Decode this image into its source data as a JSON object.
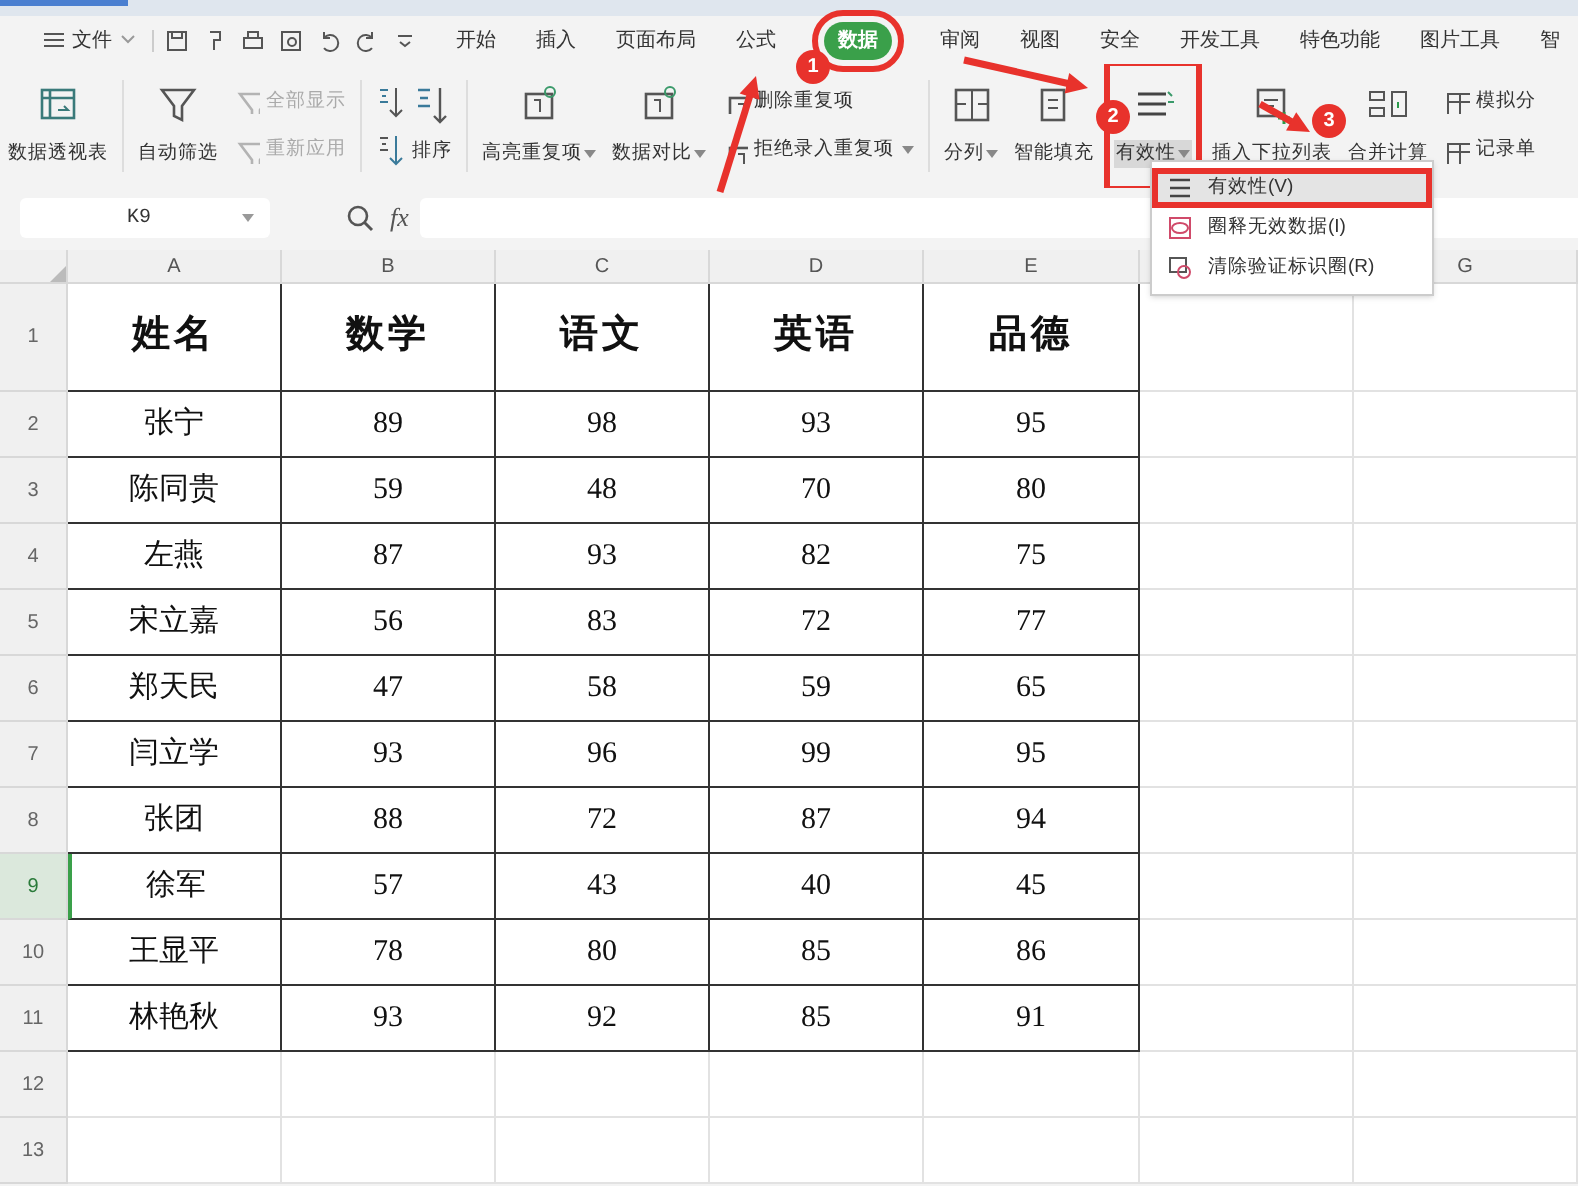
{
  "menu_bar": {
    "file": "文件",
    "tabs": [
      {
        "label": "开始",
        "selected": false
      },
      {
        "label": "插入",
        "selected": false
      },
      {
        "label": "页面布局",
        "selected": false
      },
      {
        "label": "公式",
        "selected": false
      },
      {
        "label": "数据",
        "selected": true
      },
      {
        "label": "审阅",
        "selected": false
      },
      {
        "label": "视图",
        "selected": false
      },
      {
        "label": "安全",
        "selected": false
      },
      {
        "label": "开发工具",
        "selected": false
      },
      {
        "label": "特色功能",
        "selected": false
      },
      {
        "label": "图片工具",
        "selected": false
      },
      {
        "label": "智",
        "selected": false
      }
    ]
  },
  "ribbon": [
    {
      "kind": "big",
      "label": "数据透视表",
      "dropdown": false,
      "selected": false
    },
    {
      "kind": "big",
      "label": "自动筛选",
      "dropdown": false,
      "selected": false
    },
    {
      "kind": "pair",
      "items": [
        {
          "label": "全部显示",
          "disabled": true,
          "dropdown": false
        },
        {
          "label": "重新应用",
          "disabled": true,
          "dropdown": false
        }
      ]
    },
    {
      "kind": "sort",
      "label": "排序"
    },
    {
      "kind": "big",
      "label": "高亮重复项",
      "dropdown": true,
      "selected": false
    },
    {
      "kind": "big",
      "label": "数据对比",
      "dropdown": true,
      "selected": false
    },
    {
      "kind": "pair",
      "items": [
        {
          "label": "删除重复项",
          "disabled": false,
          "dropdown": false
        },
        {
          "label": "拒绝录入重复项",
          "disabled": false,
          "dropdown": true
        }
      ]
    },
    {
      "kind": "big",
      "label": "分列",
      "dropdown": true,
      "selected": false
    },
    {
      "kind": "big",
      "label": "智能填充",
      "dropdown": false,
      "selected": false
    },
    {
      "kind": "big",
      "label": "有效性",
      "dropdown": true,
      "selected": true
    },
    {
      "kind": "big",
      "label": "插入下拉列表",
      "dropdown": false,
      "selected": false
    },
    {
      "kind": "big",
      "label": "合并计算",
      "dropdown": false,
      "selected": false
    },
    {
      "kind": "pair",
      "items": [
        {
          "label": "模拟分",
          "disabled": false,
          "dropdown": false
        },
        {
          "label": "记录单",
          "disabled": false,
          "dropdown": false
        }
      ]
    }
  ],
  "dropdown_menu": [
    {
      "label": "有效性(V)",
      "selected": true
    },
    {
      "label": "圈释无效数据(I)",
      "selected": false
    },
    {
      "label": "清除验证标识圈(R)",
      "selected": false
    }
  ],
  "formula_bar": {
    "name_box": "K9",
    "fx": "fx"
  },
  "columns": [
    "A",
    "B",
    "C",
    "D",
    "E",
    null,
    "G"
  ],
  "rows": [
    {
      "number": "1",
      "selected": false,
      "cells": [
        "姓名",
        "数学",
        "语文",
        "英语",
        "品德"
      ]
    },
    {
      "number": "2",
      "selected": false,
      "cells": [
        "张宁",
        "89",
        "98",
        "93",
        "95"
      ]
    },
    {
      "number": "3",
      "selected": false,
      "cells": [
        "陈同贵",
        "59",
        "48",
        "70",
        "80"
      ]
    },
    {
      "number": "4",
      "selected": false,
      "cells": [
        "左燕",
        "87",
        "93",
        "82",
        "75"
      ]
    },
    {
      "number": "5",
      "selected": false,
      "cells": [
        "宋立嘉",
        "56",
        "83",
        "72",
        "77"
      ]
    },
    {
      "number": "6",
      "selected": false,
      "cells": [
        "郑天民",
        "47",
        "58",
        "59",
        "65"
      ]
    },
    {
      "number": "7",
      "selected": false,
      "cells": [
        "闫立学",
        "93",
        "96",
        "99",
        "95"
      ]
    },
    {
      "number": "8",
      "selected": false,
      "cells": [
        "张团",
        "88",
        "72",
        "87",
        "94"
      ]
    },
    {
      "number": "9",
      "selected": true,
      "cells": [
        "徐军",
        "57",
        "43",
        "40",
        "45"
      ]
    },
    {
      "number": "10",
      "selected": false,
      "cells": [
        "王显平",
        "78",
        "80",
        "85",
        "86"
      ]
    },
    {
      "number": "11",
      "selected": false,
      "cells": [
        "林艳秋",
        "93",
        "92",
        "85",
        "91"
      ]
    },
    {
      "number": "12",
      "selected": false,
      "cells": []
    },
    {
      "number": "13",
      "selected": false,
      "cells": []
    }
  ],
  "annotations": [
    {
      "label": "1"
    },
    {
      "label": "2"
    },
    {
      "label": "3"
    }
  ]
}
